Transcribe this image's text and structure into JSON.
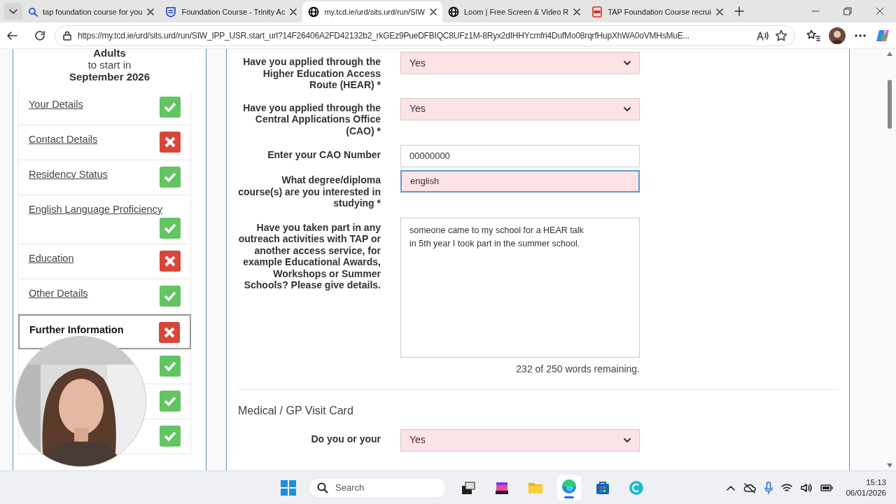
{
  "browser": {
    "tabs": [
      {
        "title": "tap foundation course for you",
        "selected": false
      },
      {
        "title": "Foundation Course - Trinity Ac",
        "selected": false
      },
      {
        "title": "my.tcd.ie/urd/sits.urd/run/SIW",
        "selected": true
      },
      {
        "title": "Loom | Free Screen & Video R",
        "selected": false
      },
      {
        "title": "TAP Foundation Course recrui",
        "selected": false
      }
    ],
    "address": "https://my.tcd.ie/urd/sits.urd/run/SIW_IPP_USR.start_url?14F26406A2FD42132b2_rkGEz9PueDFBIQC8UFz1M-8Ryx2dIHHYcmfri4DufMo08rqrfHupXhWA0oVMHsMuE..."
  },
  "sidebar": {
    "heading": [
      "Adults",
      "to start in",
      "September 2026"
    ],
    "items": [
      {
        "label": "Your Details",
        "complete": true,
        "selected": false
      },
      {
        "label": "Contact Details",
        "complete": false,
        "selected": false
      },
      {
        "label": "Residency Status",
        "complete": true,
        "selected": false
      },
      {
        "label": "English Language Proficiency",
        "complete": true,
        "selected": false
      },
      {
        "label": "Education",
        "complete": false,
        "selected": false
      },
      {
        "label": "Other Details",
        "complete": true,
        "selected": false
      },
      {
        "label": "Further Information",
        "complete": false,
        "selected": true
      },
      {
        "complete": true
      },
      {
        "complete": true
      },
      {
        "complete": true
      }
    ]
  },
  "form": {
    "rows": [
      {
        "kind": "select",
        "label": "Have you applied through the Higher Education Access Route (HEAR) *",
        "value": "Yes",
        "required": true,
        "focused": false
      },
      {
        "kind": "select",
        "label": "Have you applied through the Central Applications Office (CAO) *",
        "value": "Yes",
        "required": true,
        "focused": false
      },
      {
        "kind": "input",
        "label": "Enter your CAO Number",
        "value": "00000000",
        "required": false,
        "focused": false
      },
      {
        "kind": "input",
        "label": "What degree/diploma course(s) are you interested in studying *",
        "value": "english",
        "required": true,
        "focused": true
      },
      {
        "kind": "textarea",
        "label": "Have you taken part in any outreach activities with TAP or another access service, for example Educational Awards, Workshops or Summer Schools? Please give details.",
        "value": "someone came to my school for a HEAR talk\nin 5th year I took part in the summer school.",
        "required": false,
        "focused": false,
        "counter": "232 of 250 words remaining."
      }
    ],
    "section": "Medical / GP Visit Card",
    "last_row": {
      "kind": "select",
      "label": "Do you or your",
      "value": "Yes",
      "required": true,
      "focused": false
    }
  },
  "taskbar": {
    "search_placeholder": "Search",
    "time": "15:13",
    "date": "06/01/2026"
  }
}
